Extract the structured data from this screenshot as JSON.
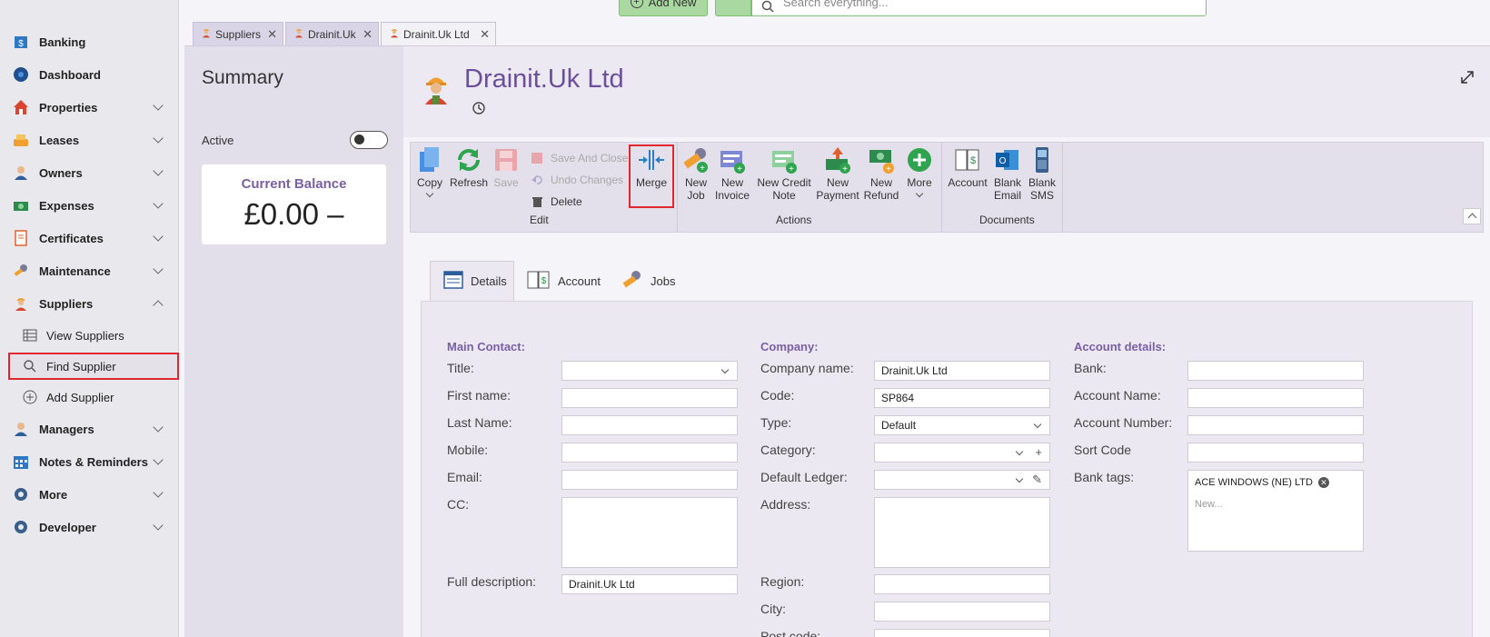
{
  "topbar": {
    "add_new_label": "Add New",
    "search_placeholder": "Search everything..."
  },
  "sidebar": {
    "items": [
      {
        "label": "Banking",
        "icon": "bank-icon"
      },
      {
        "label": "Dashboard",
        "icon": "dashboard-icon"
      },
      {
        "label": "Properties",
        "icon": "house-icon"
      },
      {
        "label": "Leases",
        "icon": "lease-icon"
      },
      {
        "label": "Owners",
        "icon": "owner-icon"
      },
      {
        "label": "Expenses",
        "icon": "money-icon"
      },
      {
        "label": "Certificates",
        "icon": "certificate-icon"
      },
      {
        "label": "Maintenance",
        "icon": "wrench-icon"
      },
      {
        "label": "Suppliers",
        "icon": "worker-icon"
      },
      {
        "label": "Managers",
        "icon": "manager-icon"
      },
      {
        "label": "Notes & Reminders",
        "icon": "calendar-icon"
      },
      {
        "label": "More",
        "icon": "gear-icon"
      },
      {
        "label": "Developer",
        "icon": "gear-icon"
      }
    ],
    "sub_items": [
      {
        "label": "View Suppliers",
        "icon": "list-icon"
      },
      {
        "label": "Find Supplier",
        "icon": "search-icon"
      },
      {
        "label": "Add Supplier",
        "icon": "add-circle-icon"
      }
    ]
  },
  "tabs": [
    {
      "label": "Suppliers"
    },
    {
      "label": "Drainit.Uk"
    },
    {
      "label": "Drainit.Uk Ltd"
    }
  ],
  "summary": {
    "title": "Summary",
    "active_label": "Active",
    "balance_label": "Current Balance",
    "balance_value": "£0.00 –"
  },
  "header": {
    "title": "Drainit.Uk Ltd"
  },
  "ribbon": {
    "copy": "Copy",
    "refresh": "Refresh",
    "save": "Save",
    "save_close": "Save And Close",
    "undo": "Undo Changes",
    "delete": "Delete",
    "merge": "Merge",
    "edit_group": "Edit",
    "new_job_1": "New",
    "new_job_2": "Job",
    "new_invoice_1": "New",
    "new_invoice_2": "Invoice",
    "new_credit_1": "New Credit",
    "new_credit_2": "Note",
    "new_payment_1": "New",
    "new_payment_2": "Payment",
    "new_refund_1": "New",
    "new_refund_2": "Refund",
    "more": "More",
    "actions_group": "Actions",
    "account": "Account",
    "blank_email_1": "Blank",
    "blank_email_2": "Email",
    "blank_sms_1": "Blank",
    "blank_sms_2": "SMS",
    "documents_group": "Documents"
  },
  "detail_tabs": {
    "details": "Details",
    "account": "Account",
    "jobs": "Jobs"
  },
  "form": {
    "main_contact": {
      "heading": "Main Contact:",
      "title": "Title:",
      "first_name": "First name:",
      "last_name": "Last Name:",
      "mobile": "Mobile:",
      "email": "Email:",
      "cc": "CC:",
      "full_description": "Full description:",
      "full_description_value": "Drainit.Uk Ltd"
    },
    "company": {
      "heading": "Company:",
      "company_name": "Company name:",
      "company_name_value": "Drainit.Uk Ltd",
      "code": "Code:",
      "code_value": "SP864",
      "type": "Type:",
      "type_value": "Default",
      "category": "Category:",
      "default_ledger": "Default Ledger:",
      "address": "Address:",
      "region": "Region:",
      "city": "City:",
      "post_code": "Post code:"
    },
    "account_details": {
      "heading": "Account details:",
      "bank": "Bank:",
      "account_name": "Account Name:",
      "account_number": "Account Number:",
      "sort_code": "Sort Code",
      "bank_tags": "Bank tags:",
      "tag_value": "ACE WINDOWS (NE) LTD",
      "tag_placeholder": "New..."
    }
  },
  "colors": {
    "accent": "#7a5fa5",
    "highlight": "#e0282e",
    "sidebar_bg": "#e9e8ec"
  }
}
